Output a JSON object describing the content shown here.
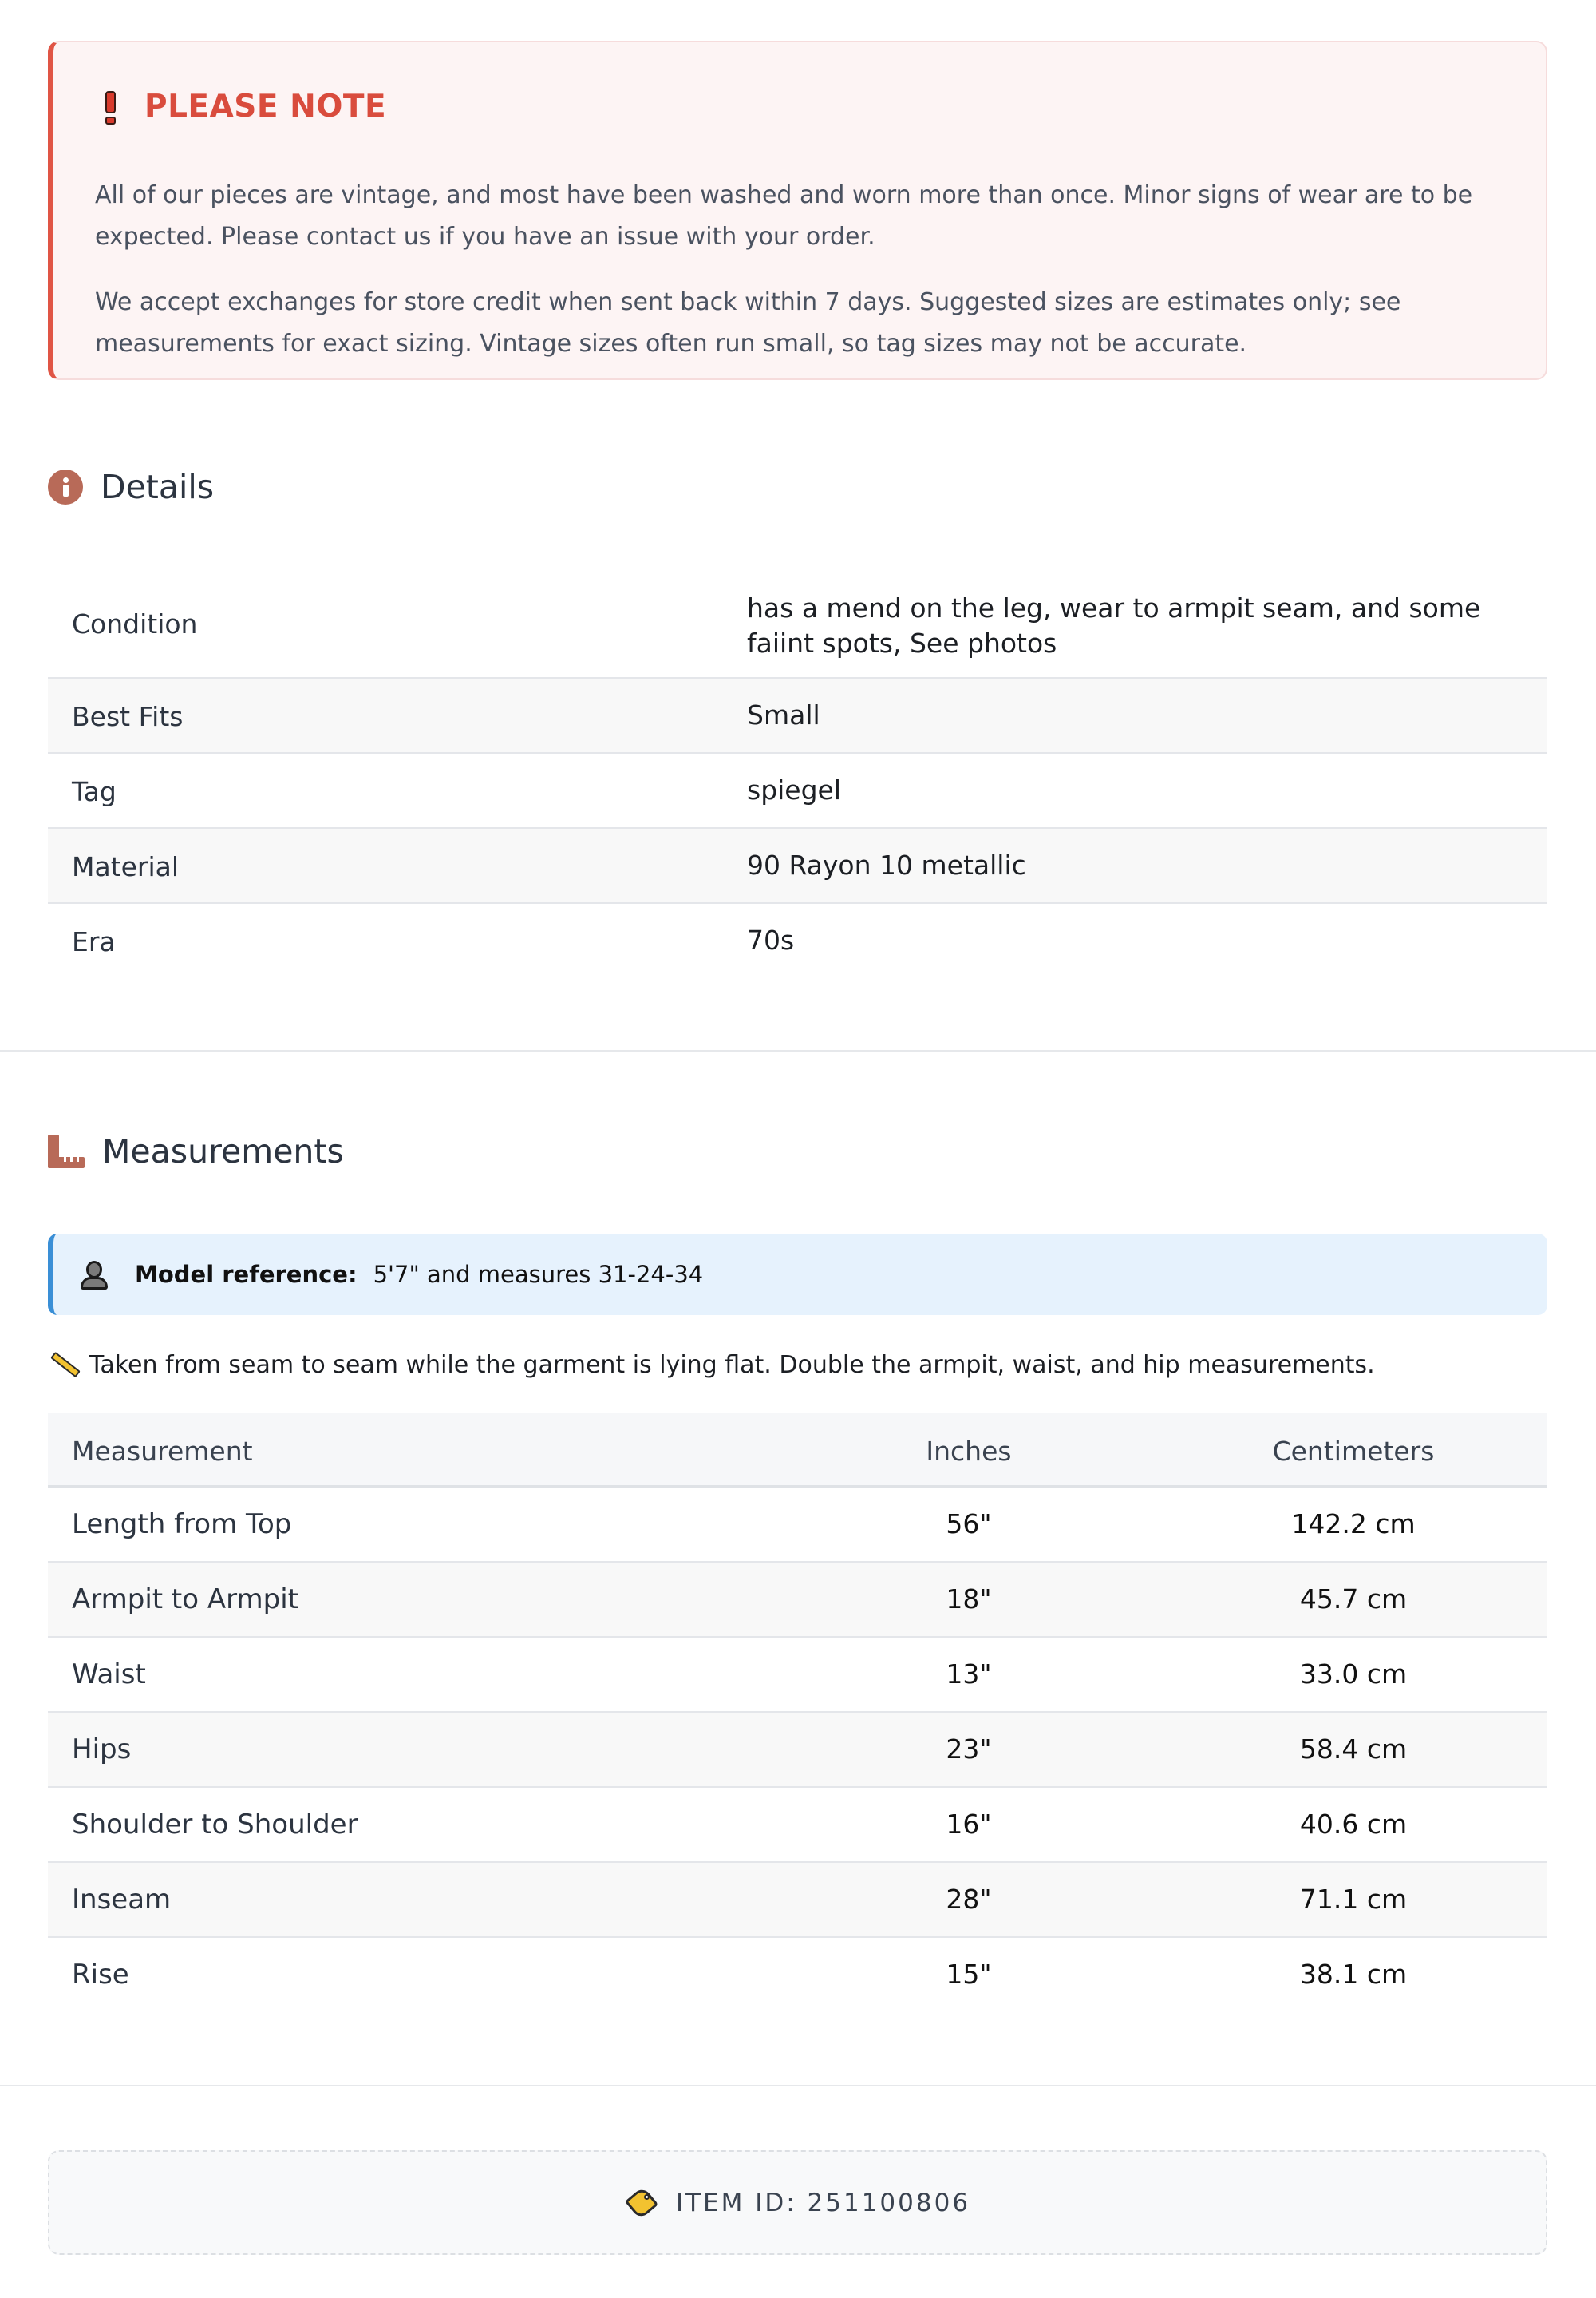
{
  "note": {
    "title": "PLEASE NOTE",
    "p1": "All of our pieces are vintage, and most have been washed and worn more than once. Minor signs of wear are to be expected. Please contact us if you have an issue with your order.",
    "p2": "We accept exchanges for store credit when sent back within 7 days. Suggested sizes are estimates only; see measurements for exact sizing. Vintage sizes often run small, so tag sizes may not be accurate.",
    "accent_color": "#e05545"
  },
  "details": {
    "title": "Details",
    "icon": "info-icon",
    "rows": [
      {
        "label": "Condition",
        "value": "has a mend on the leg, wear to armpit seam, and some faiint spots, See photos"
      },
      {
        "label": "Best Fits",
        "value": "Small"
      },
      {
        "label": "Tag",
        "value": "spiegel"
      },
      {
        "label": "Material",
        "value": "90 Rayon 10 metallic"
      },
      {
        "label": "Era",
        "value": "70s"
      }
    ]
  },
  "measurements": {
    "title": "Measurements",
    "icon": "ruler-icon",
    "model_label": "Model reference:",
    "model_text": "5'7\" and measures 31-24-34",
    "note": "Taken from seam to seam while the garment is lying flat. Double the armpit, waist, and hip measurements.",
    "headers": {
      "name": "Measurement",
      "inches": "Inches",
      "cm": "Centimeters"
    },
    "rows": [
      {
        "name": "Length from Top",
        "inches": "56\"",
        "cm": "142.2 cm"
      },
      {
        "name": "Armpit to Armpit",
        "inches": "18\"",
        "cm": "45.7 cm"
      },
      {
        "name": "Waist",
        "inches": "13\"",
        "cm": "33.0 cm"
      },
      {
        "name": "Hips",
        "inches": "23\"",
        "cm": "58.4 cm"
      },
      {
        "name": "Shoulder to Shoulder",
        "inches": "16\"",
        "cm": "40.6 cm"
      },
      {
        "name": "Inseam",
        "inches": "28\"",
        "cm": "71.1 cm"
      },
      {
        "name": "Rise",
        "inches": "15\"",
        "cm": "38.1 cm"
      }
    ]
  },
  "item": {
    "id_text": "ITEM ID: 251100806",
    "icon": "tag-icon"
  }
}
